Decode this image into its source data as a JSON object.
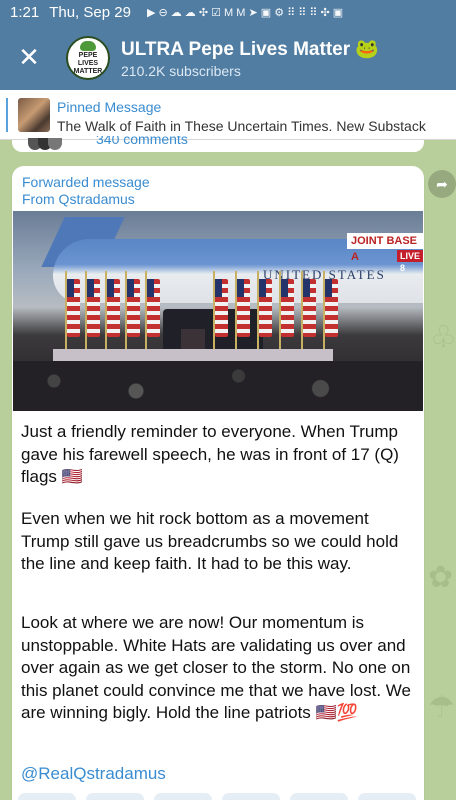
{
  "status_bar": {
    "time": "1:21",
    "date": "Thu, Sep 29",
    "icons": [
      "notification-icons",
      "wifi-icon",
      "battery-icon"
    ]
  },
  "header": {
    "back_icon": "close-icon",
    "channel_name": "ULTRA Pepe Lives Matter 🐸",
    "subscribers": "210.2K subscribers",
    "avatar_text": [
      "PEPE",
      "LIVES",
      "MATTER"
    ],
    "bg_color": "#517da2"
  },
  "pinned": {
    "label": "Pinned Message",
    "text": "The Walk of Faith in These Uncertain Times.  New Substack",
    "accent": "#3a8cd1"
  },
  "previous_post": {
    "comments_label": "340 comments"
  },
  "post": {
    "forwarded_label": "Forwarded message",
    "from_label": "From Qstradamus",
    "photo": {
      "banner": "JOINT BASE A",
      "live": "LIVE | 8",
      "plane_text": "UNITED STATES"
    },
    "paragraph_1": "Just a friendly reminder to everyone. When Trump gave his farewell speech, he was in front of 17 (Q) flags 🇺🇸",
    "paragraph_2": "Even when we hit rock bottom as a movement Trump still gave us breadcrumbs so we could hold the line and keep faith. It had to be this way.",
    "paragraph_3": "Look at where we are now! Our momentum is unstoppable. White Hats are validating us over and over again as we get closer to the storm. No one on this planet could convince me that we have lost. We are winning bigly. Hold the line patriots 🇺🇸💯",
    "signature": "@RealQstradamus"
  },
  "colors": {
    "chat_bg": "#b9cf9b",
    "link": "#3a8cd1"
  }
}
